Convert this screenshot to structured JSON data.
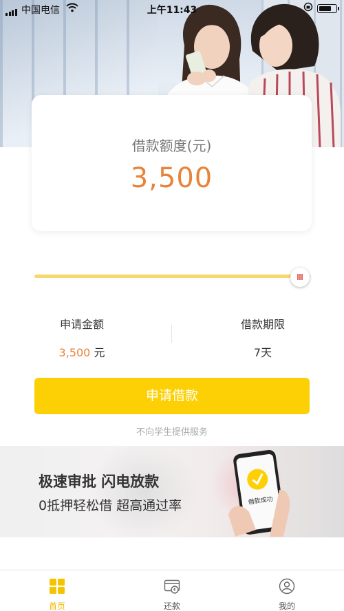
{
  "status_bar": {
    "carrier": "中国电信",
    "time": "上午11:43",
    "wifi_icon": "wifi-icon",
    "lock_icon": "orientation-lock-icon",
    "battery_icon": "battery-icon"
  },
  "quota_card": {
    "label": "借款额度(元)",
    "amount": "3,500"
  },
  "slider": {
    "fill_fraction": 0.96
  },
  "apply_info": {
    "amount_title": "申请金额",
    "amount_value": "3,500",
    "amount_unit": " 元",
    "term_title": "借款期限",
    "term_value": "7天"
  },
  "apply_button": {
    "label": "申请借款"
  },
  "notice": "不向学生提供服务",
  "banner": {
    "headline": "极速审批 闪电放款",
    "subline": "0抵押轻松借 超高通过率",
    "phone_text": "借款成功"
  },
  "tab_bar": {
    "tabs": [
      {
        "label": "首页",
        "icon": "home-grid-icon",
        "active": true
      },
      {
        "label": "还款",
        "icon": "repay-card-icon",
        "active": false
      },
      {
        "label": "我的",
        "icon": "user-icon",
        "active": false
      }
    ]
  },
  "colors": {
    "accent_yellow": "#fdd006",
    "amount_orange": "#e8833a",
    "slider_fill": "#f7d86b",
    "tab_active": "#f0b800"
  }
}
